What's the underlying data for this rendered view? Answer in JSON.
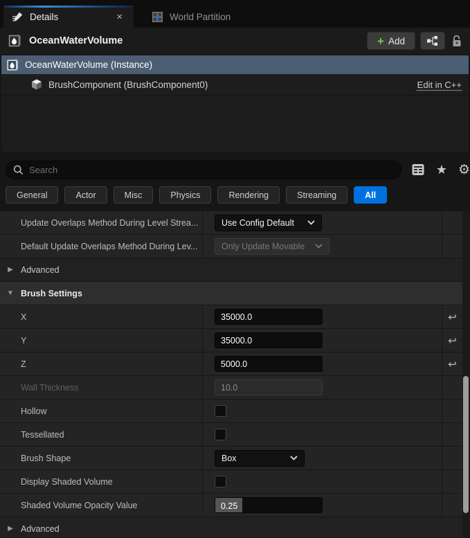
{
  "tab_bar": {
    "details_tab": "Details",
    "world_partition_tab": "World Partition"
  },
  "header": {
    "title": "OceanWaterVolume",
    "add_button": "Add"
  },
  "tree": {
    "instance_label": "OceanWaterVolume (Instance)",
    "component_label": "BrushComponent (BrushComponent0)",
    "edit_link": "Edit in C++"
  },
  "search": {
    "placeholder": "Search"
  },
  "filters": {
    "general": "General",
    "actor": "Actor",
    "misc": "Misc",
    "physics": "Physics",
    "rendering": "Rendering",
    "streaming": "Streaming",
    "all": "All"
  },
  "properties": {
    "update_overlaps": {
      "label": "Update Overlaps Method During Level Strea...",
      "value": "Use Config Default"
    },
    "default_update_overlaps": {
      "label": "Default Update Overlaps Method During Lev...",
      "value": "Only Update Movable"
    },
    "advanced_top": {
      "label": "Advanced"
    },
    "brush_settings": {
      "label": "Brush Settings"
    },
    "x": {
      "label": "X",
      "value": "35000.0"
    },
    "y": {
      "label": "Y",
      "value": "35000.0"
    },
    "z": {
      "label": "Z",
      "value": "5000.0"
    },
    "wall_thickness": {
      "label": "Wall Thickness",
      "value": "10.0"
    },
    "hollow": {
      "label": "Hollow"
    },
    "tessellated": {
      "label": "Tessellated"
    },
    "brush_shape": {
      "label": "Brush Shape",
      "value": "Box"
    },
    "display_shaded_volume": {
      "label": "Display Shaded Volume"
    },
    "shaded_volume_opacity": {
      "label": "Shaded Volume Opacity Value",
      "value": "0.25"
    },
    "advanced_bottom": {
      "label": "Advanced"
    }
  },
  "icons": {
    "close": "×",
    "plus": "+",
    "star": "★",
    "gear": "⚙",
    "reset": "↩",
    "collapsed": "▶",
    "expanded": "▼"
  },
  "colors": {
    "accent_blue": "#0070e0",
    "selection_blue_gray": "#4c5e73",
    "add_plus_green": "#84c141"
  }
}
